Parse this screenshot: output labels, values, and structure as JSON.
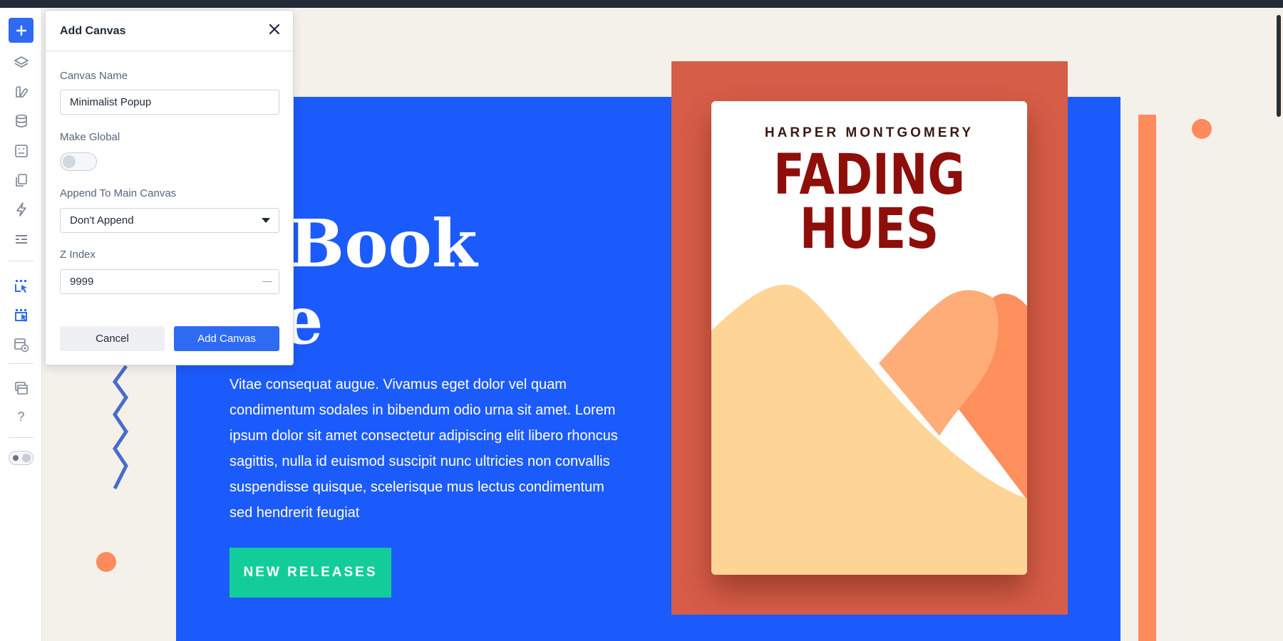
{
  "modal": {
    "title": "Add Canvas",
    "fields": {
      "canvas_name": {
        "label": "Canvas Name",
        "value": "Minimalist Popup"
      },
      "make_global": {
        "label": "Make Global",
        "checked": false
      },
      "append": {
        "label": "Append To Main Canvas",
        "selected": "Don't Append"
      },
      "z_index": {
        "label": "Z Index",
        "value": "9999"
      }
    },
    "buttons": {
      "cancel": "Cancel",
      "submit": "Add Canvas"
    }
  },
  "page": {
    "title_line1": "vi Book",
    "title_line2": "ore",
    "paragraph": "Vitae consequat augue. Vivamus eget dolor vel quam condimentum sodales in bibendum odio urna sit amet. Lorem ipsum dolor sit amet consectetur adipiscing elit libero rhoncus sagittis, nulla id euismod suscipit nunc ultricies non convallis suspendisse quisque, scelerisque mus lectus condimentum sed hendrerit feugiat",
    "cta": "NEW RELEASES",
    "book": {
      "author": "HARPER MONTGOMERY",
      "title_line1": "FADING",
      "title_line2": "HUES"
    }
  },
  "toolbar": {
    "icons": [
      "plus-icon",
      "layers-icon",
      "elements-icon",
      "database-icon",
      "form-icon",
      "pages-icon",
      "lightning-icon",
      "list-icon",
      "canvas-add-icon",
      "canvas-select-icon",
      "preview-icon",
      "windows-icon",
      "help-icon",
      "theme-toggle-icon"
    ],
    "help_glyph": "?"
  },
  "colors": {
    "hero_blue": "#1c5bfb",
    "accent_blue": "#2f6bf2",
    "cta_green": "#12cd9a",
    "book_frame": "#d65d48",
    "orange": "#ff8a5b"
  }
}
